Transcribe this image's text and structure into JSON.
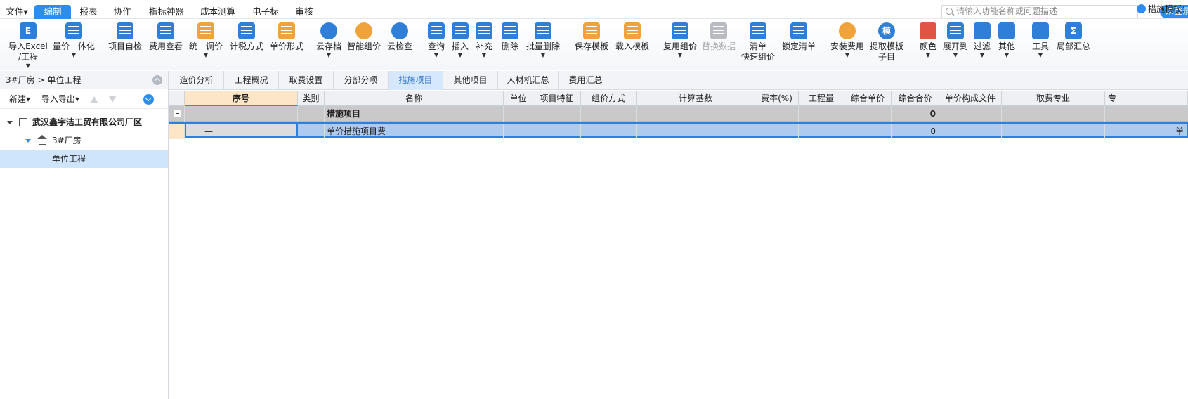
{
  "menu": {
    "items": [
      "文件▾",
      "编制",
      "报表",
      "协作",
      "指标神器",
      "成本测算",
      "电子标",
      "审核"
    ],
    "active": "编制",
    "search_placeholder": "请输入功能名称或问题描述",
    "login": "未登录"
  },
  "toolbar": {
    "import_excel_line1": "导入Excel",
    "import_excel_line2": "/工程",
    "bill_integrate": "量价一体化",
    "self_check": "项目自检",
    "fee_check": "费用查看",
    "unify_price": "统一调价",
    "tax_method": "计税方式",
    "unit_price_form": "单价形式",
    "cloud_save": "云存档",
    "smart_price": "智能组价",
    "cloud_check": "云检查",
    "query": "查询",
    "insert": "插入",
    "supplement": "补充",
    "delete": "删除",
    "batch_delete": "批量删除",
    "save_template": "保存模板",
    "load_template": "载入模板",
    "reuse_price": "复用组价",
    "replace_data": "替换数据",
    "quick_price_line1": "清单",
    "quick_price_line2": "快速组价",
    "lock_list": "锁定清单",
    "install_fee": "安装费用",
    "extract_template_line1": "提取模板",
    "extract_template_line2": "子目",
    "color": "颜色",
    "expand_to": "展开到",
    "filter": "过滤",
    "other": "其他",
    "tools": "工具",
    "partial_summary": "局部汇总",
    "icon_import": "E",
    "icon_mo": "模"
  },
  "left": {
    "breadcrumb": "3#厂房 > 单位工程",
    "new": "新建▾",
    "import_export": "导入导出▾",
    "tree": {
      "company": "武汉鑫宇洁工贸有限公司厂区",
      "building": "3#厂房",
      "unit": "单位工程"
    }
  },
  "tabs": {
    "items": [
      "造价分析",
      "工程概况",
      "取费设置",
      "分部分项",
      "措施项目",
      "其他项目",
      "人材机汇总",
      "费用汇总"
    ],
    "active": "措施项目",
    "template_label": "措施模板："
  },
  "grid": {
    "columns": [
      "",
      "序号",
      "类别",
      "名称",
      "单位",
      "项目特征",
      "组价方式",
      "计算基数",
      "费率(%)",
      "工程量",
      "综合单价",
      "综合合价",
      "单价构成文件",
      "取费专业",
      "专"
    ],
    "rows": [
      {
        "seq": "",
        "name": "措施项目",
        "total": "0",
        "extra": ""
      },
      {
        "seq": "—",
        "name": "单价措施项目费",
        "total": "0",
        "extra": "单"
      }
    ]
  },
  "colors": {
    "accent": "#2d8cf0",
    "header_seq_bg": "#fde6c8",
    "selected_row_bg": "#aecbef",
    "group_row_bg": "#c9c9c9"
  }
}
